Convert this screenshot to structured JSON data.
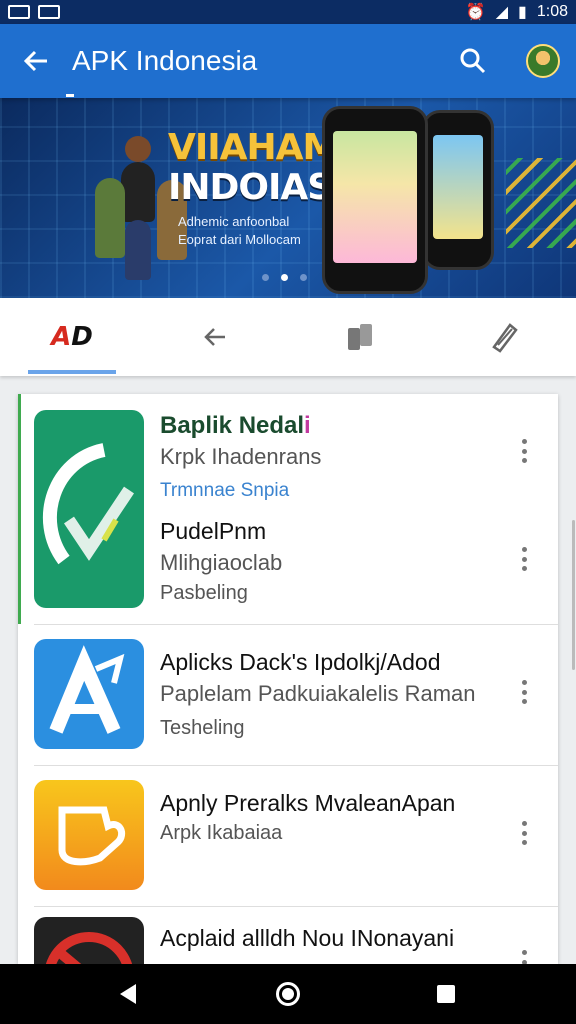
{
  "status": {
    "time": "1:08"
  },
  "app_bar": {
    "title": "APK Indonesia",
    "back_icon": "arrow-left-icon",
    "search_icon": "search-icon"
  },
  "banner": {
    "headline_1": "VIIAHAMNI",
    "headline_2": "INDOIASIA",
    "sub_1": "Adhemic anfoonbal",
    "sub_2": "Eoprat dari Mollocam",
    "active_dot": 1
  },
  "tabs": [
    {
      "name": "tab-brand",
      "brand_a": "A",
      "brand_d": "D",
      "icon": "brand-logo-icon",
      "active": true
    },
    {
      "name": "tab-back",
      "icon": "arrow-left-icon",
      "active": false
    },
    {
      "name": "tab-docs",
      "icon": "documents-icon",
      "active": false
    },
    {
      "name": "tab-edit",
      "icon": "pencil-icon",
      "active": false
    }
  ],
  "apps": [
    {
      "name": "Baplik Nedal",
      "name_suffix": "i",
      "developer": "Krpk Ihadenrans",
      "category": "Trmnnae Snpia",
      "title2": "PudelPnm",
      "sub2": "Mlihgiaoclab",
      "status": "Pasbeling",
      "icon_color": "#1a9a6a"
    },
    {
      "name": "Aplicks Dack's Ipdolkj/Adod",
      "developer": "Paplelam Padkuiakalelis Raman",
      "status": "Tesheling",
      "icon_color": "#2b8fe0"
    },
    {
      "name": "Apnly Preralks MvaleanApan",
      "developer": "Arpk Ikabaiaa",
      "icon_color": "#f5a623"
    },
    {
      "name": "Acplaid allldh Nou INonayani",
      "icon_color": "#d8302a"
    }
  ],
  "colors": {
    "app_bar": "#1f6fcf",
    "status_bar": "#0c2c63",
    "accent": "#6aa4ea",
    "brand_red": "#d62a1f"
  }
}
